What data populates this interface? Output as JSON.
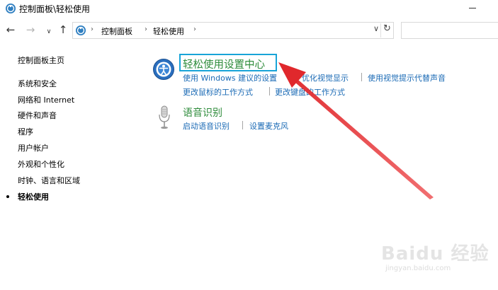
{
  "window": {
    "title": "控制面板\\轻松使用"
  },
  "address": {
    "crumbs": [
      "控制面板",
      "轻松使用"
    ],
    "search_placeholder": ""
  },
  "sidebar": {
    "home": "控制面板主页",
    "items": [
      {
        "label": "系统和安全"
      },
      {
        "label": "网络和 Internet"
      },
      {
        "label": "硬件和声音"
      },
      {
        "label": "程序"
      },
      {
        "label": "用户帐户"
      },
      {
        "label": "外观和个性化"
      },
      {
        "label": "时钟、语言和区域"
      },
      {
        "label": "轻松使用",
        "current": true
      }
    ]
  },
  "main": {
    "ease_center": {
      "title": "轻松使用设置中心",
      "links": [
        "使用 Windows 建议的设置",
        "优化视觉显示",
        "使用视觉提示代替声音",
        "更改鼠标的工作方式",
        "更改键盘的工作方式"
      ]
    },
    "speech": {
      "title": "语音识别",
      "links": [
        "启动语音识别",
        "设置麦克风"
      ]
    }
  },
  "watermark": {
    "logo": "Baidu 经验",
    "url": "jingyan.baidu.com"
  },
  "colors": {
    "title_green": "#2d8b3a",
    "link_blue": "#1a6ab5",
    "highlight": "#18a4d8",
    "arrow_red": "#e0282c"
  }
}
